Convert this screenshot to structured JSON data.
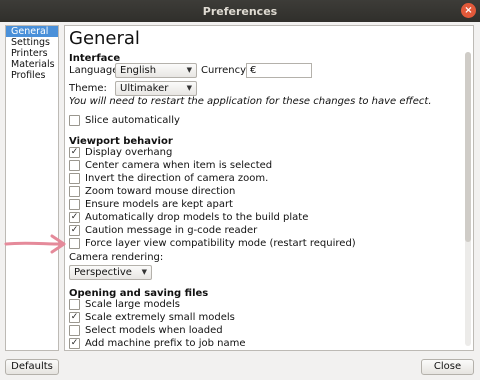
{
  "window": {
    "title": "Preferences",
    "close_glyph": "×"
  },
  "sidebar": {
    "items": [
      {
        "label": "General",
        "selected": true
      },
      {
        "label": "Settings"
      },
      {
        "label": "Printers"
      },
      {
        "label": "Materials"
      },
      {
        "label": "Profiles"
      }
    ]
  },
  "general": {
    "title": "General",
    "interface": {
      "heading": "Interface",
      "language_label": "Language:",
      "language_value": "English",
      "currency_label": "Currency:",
      "currency_value": "€",
      "theme_label": "Theme:",
      "theme_value": "Ultimaker",
      "restart_note": "You will need to restart the application for these changes to have effect.",
      "slice_auto": {
        "label": "Slice automatically",
        "checked": false
      }
    },
    "viewport": {
      "heading": "Viewport behavior",
      "options": [
        {
          "label": "Display overhang",
          "checked": true
        },
        {
          "label": "Center camera when item is selected",
          "checked": false
        },
        {
          "label": "Invert the direction of camera zoom.",
          "checked": false
        },
        {
          "label": "Zoom toward mouse direction",
          "checked": false
        },
        {
          "label": "Ensure models are kept apart",
          "checked": false
        },
        {
          "label": "Automatically drop models to the build plate",
          "checked": true
        },
        {
          "label": "Caution message in g-code reader",
          "checked": true
        },
        {
          "label": "Force layer view compatibility mode (restart required)",
          "checked": false
        }
      ],
      "camera_label": "Camera rendering:",
      "camera_value": "Perspective"
    },
    "files": {
      "heading": "Opening and saving files",
      "options": [
        {
          "label": "Scale large models",
          "checked": false
        },
        {
          "label": "Scale extremely small models",
          "checked": true
        },
        {
          "label": "Select models when loaded",
          "checked": false
        },
        {
          "label": "Add machine prefix to job name",
          "checked": true
        }
      ]
    }
  },
  "buttons": {
    "defaults": "Defaults",
    "close": "Close"
  },
  "check_glyph": "✓",
  "combo_arrow_glyph": "▼",
  "colors": {
    "selection": "#4a90d9",
    "titlebar": "#33322e",
    "close_button": "#e2593a",
    "annotation_arrow": "#e58a9a"
  }
}
